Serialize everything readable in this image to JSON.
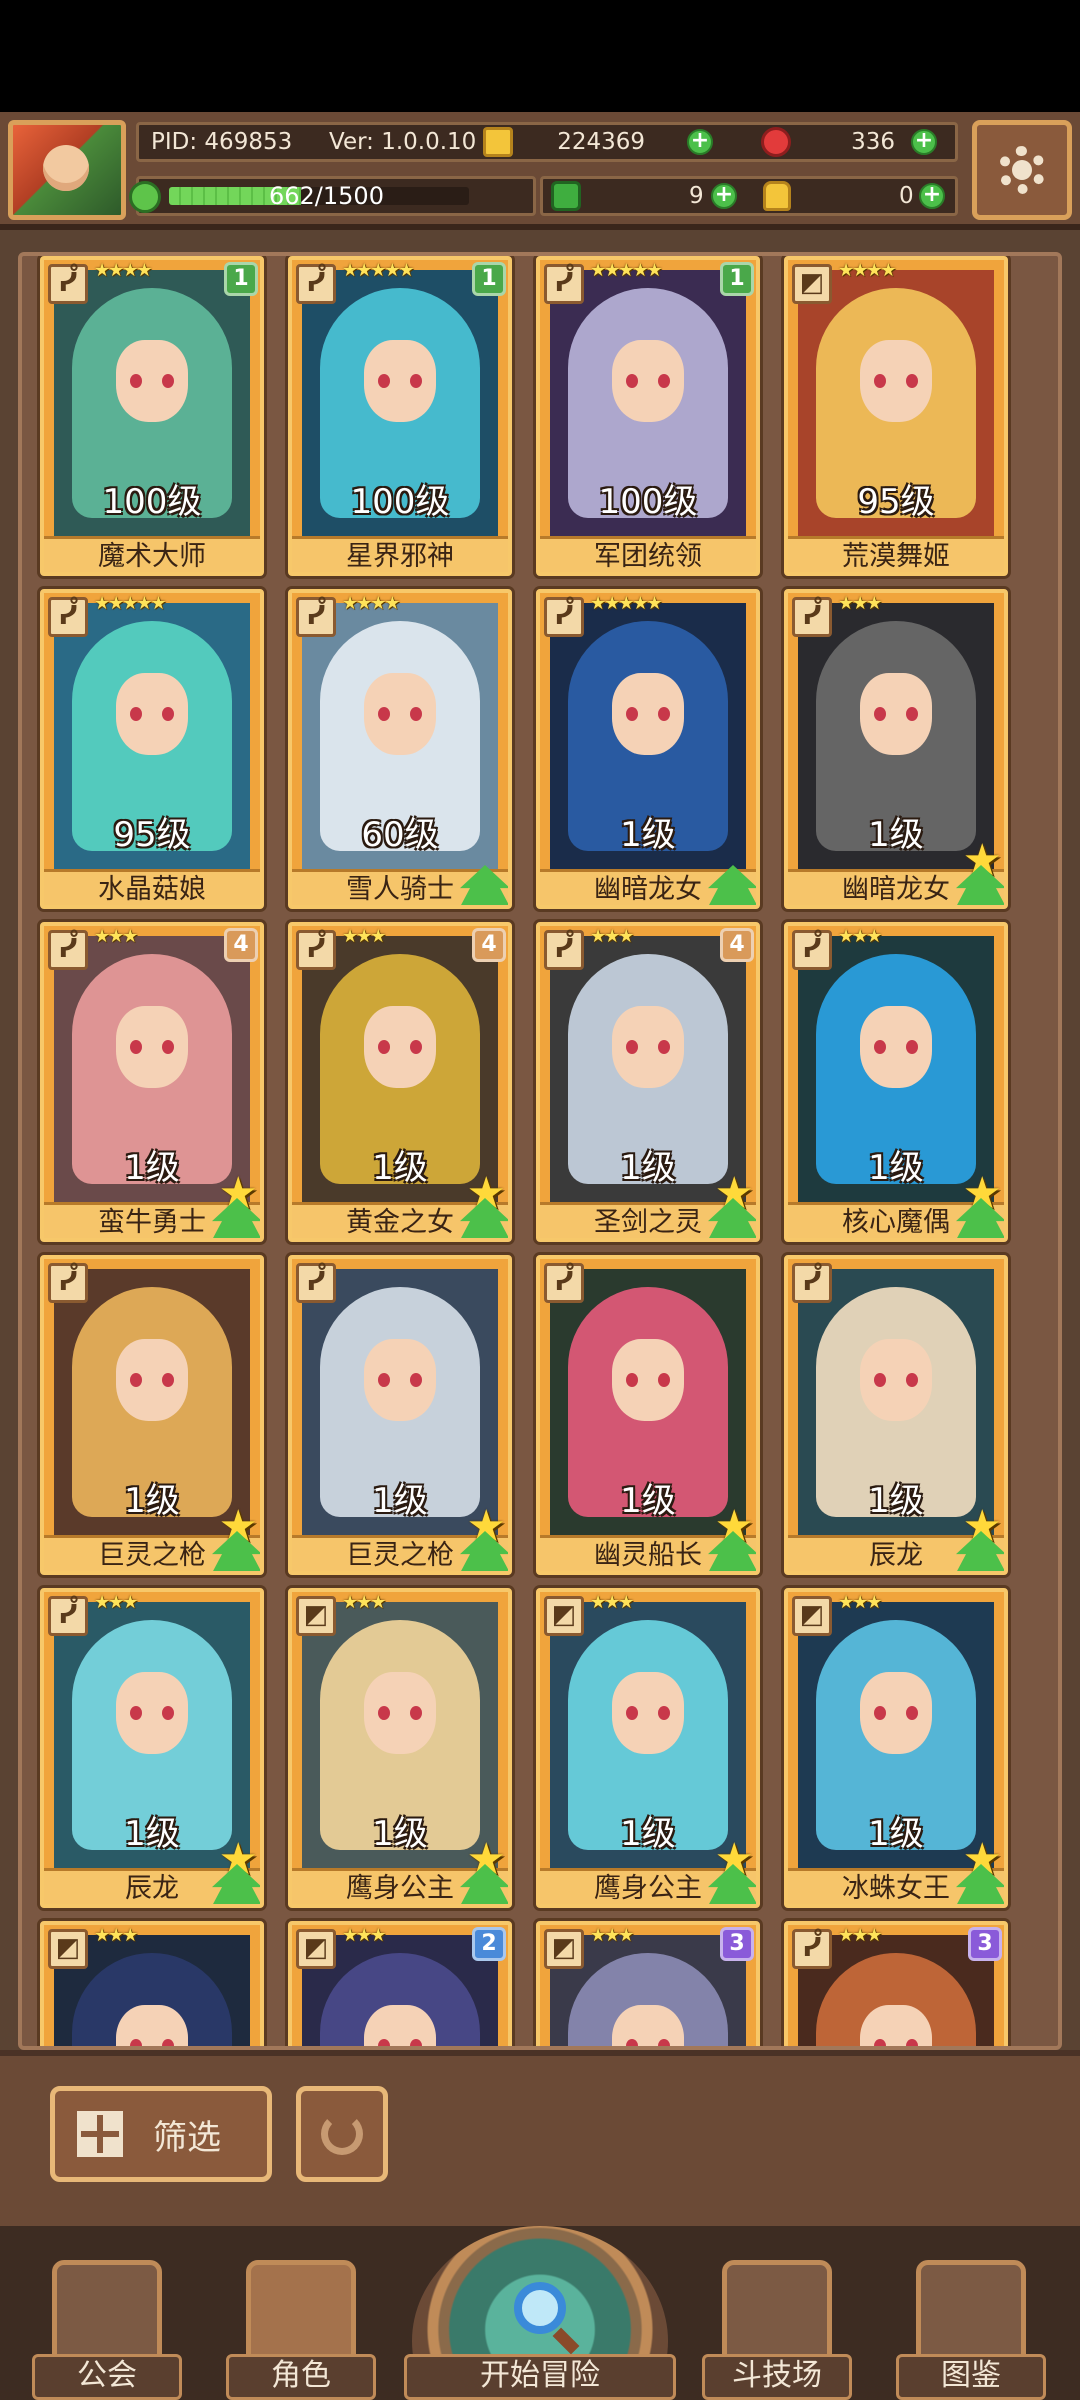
{
  "header": {
    "pid": "PID: 469853",
    "version": "Ver: 1.0.0.10",
    "gold": "224369",
    "gems": "336",
    "stamina": "662/1500",
    "stamina_fraction": 0.44,
    "clover": "9",
    "bag": "0",
    "plus": "+"
  },
  "cards": [
    {
      "name": "魔术大师",
      "level": "100级",
      "stars": "★★★★",
      "badge": "1",
      "badge_color": "#4aa84a",
      "hair": "#5fb89a",
      "bg": "#2f5a56",
      "type": "ᓮ",
      "up_star": false,
      "up_tree": false
    },
    {
      "name": "星界邪神",
      "level": "100级",
      "stars": "★★★★★",
      "badge": "1",
      "badge_color": "#4aa84a",
      "hair": "#4ac3d6",
      "bg": "#1e4e66",
      "type": "ᓮ",
      "up_star": false,
      "up_tree": false
    },
    {
      "name": "军团统领",
      "level": "100级",
      "stars": "★★★★★",
      "badge": "1",
      "badge_color": "#4aa84a",
      "hair": "#b7b2d8",
      "bg": "#3b2c52",
      "type": "ᓮ",
      "up_star": false,
      "up_tree": false
    },
    {
      "name": "荒漠舞姬",
      "level": "95级",
      "stars": "★★★★",
      "badge": "",
      "badge_color": "",
      "hair": "#f2c25a",
      "bg": "#a8442a",
      "type": "◩",
      "up_star": false,
      "up_tree": false
    },
    {
      "name": "水晶菇娘",
      "level": "95级",
      "stars": "★★★★★",
      "badge": "",
      "badge_color": "",
      "hair": "#57d2c2",
      "bg": "#2a6a86",
      "type": "ᓮ",
      "up_star": false,
      "up_tree": false
    },
    {
      "name": "雪人骑士",
      "level": "60级",
      "stars": "★★★★",
      "badge": "",
      "badge_color": "",
      "hair": "#e4ecf2",
      "bg": "#6a8aa0",
      "type": "ᓮ",
      "up_star": false,
      "up_tree": true
    },
    {
      "name": "幽暗龙女",
      "level": "1级",
      "stars": "★★★★★",
      "badge": "",
      "badge_color": "",
      "hair": "#2a5ea8",
      "bg": "#1a2c4a",
      "type": "ᓮ",
      "up_star": false,
      "up_tree": true
    },
    {
      "name": "幽暗龙女",
      "level": "1级",
      "stars": "★★★",
      "badge": "",
      "badge_color": "",
      "hair": "#6a6a6a",
      "bg": "#2a2a2e",
      "type": "ᓮ",
      "up_star": true,
      "up_tree": true
    },
    {
      "name": "蛮牛勇士",
      "level": "1级",
      "stars": "★★★",
      "badge": "4",
      "badge_color": "#d99a5a",
      "hair": "#e89a9a",
      "bg": "#6a4a4a",
      "type": "ᓮ",
      "up_star": true,
      "up_tree": true
    },
    {
      "name": "黄金之女",
      "level": "1级",
      "stars": "★★★",
      "badge": "4",
      "badge_color": "#d99a5a",
      "hair": "#d8b03a",
      "bg": "#4a3a2a",
      "type": "ᓮ",
      "up_star": true,
      "up_tree": true
    },
    {
      "name": "圣剑之灵",
      "level": "1级",
      "stars": "★★★",
      "badge": "4",
      "badge_color": "#d99a5a",
      "hair": "#c8d4e2",
      "bg": "#3a3a3a",
      "type": "ᓮ",
      "up_star": true,
      "up_tree": true
    },
    {
      "name": "核心魔偶",
      "level": "1级",
      "stars": "★★★",
      "badge": "",
      "badge_color": "",
      "hair": "#2aa2e2",
      "bg": "#1e3a3e",
      "type": "ᓮ",
      "up_star": true,
      "up_tree": true
    },
    {
      "name": "巨灵之枪",
      "level": "1级",
      "stars": "",
      "badge": "",
      "badge_color": "",
      "hair": "#e8b25a",
      "bg": "#5a3a2a",
      "type": "ᓮ",
      "up_star": true,
      "up_tree": true
    },
    {
      "name": "巨灵之枪",
      "level": "1级",
      "stars": "",
      "badge": "",
      "badge_color": "",
      "hair": "#d4dce6",
      "bg": "#3a4a5e",
      "type": "ᓮ",
      "up_star": true,
      "up_tree": true
    },
    {
      "name": "幽灵船长",
      "level": "1级",
      "stars": "",
      "badge": "",
      "badge_color": "",
      "hair": "#e25a7a",
      "bg": "#2a3a2e",
      "type": "ᓮ",
      "up_star": true,
      "up_tree": true
    },
    {
      "name": "辰龙",
      "level": "1级",
      "stars": "",
      "badge": "",
      "badge_color": "",
      "hair": "#f0dcc0",
      "bg": "#2a4a52",
      "type": "ᓮ",
      "up_star": true,
      "up_tree": true
    },
    {
      "name": "辰龙",
      "level": "1级",
      "stars": "★★★",
      "badge": "",
      "badge_color": "",
      "hair": "#7ad8e2",
      "bg": "#2a5a66",
      "type": "ᓮ",
      "up_star": true,
      "up_tree": true
    },
    {
      "name": "鹰身公主",
      "level": "1级",
      "stars": "★★★",
      "badge": "",
      "badge_color": "",
      "hair": "#f0d49a",
      "bg": "#4a5a5a",
      "type": "◩",
      "up_star": true,
      "up_tree": true
    },
    {
      "name": "鹰身公主",
      "level": "1级",
      "stars": "★★★",
      "badge": "",
      "badge_color": "",
      "hair": "#6ad4e2",
      "bg": "#2a4a5e",
      "type": "◩",
      "up_star": true,
      "up_tree": true
    },
    {
      "name": "冰蛛女王",
      "level": "1级",
      "stars": "★★★",
      "badge": "",
      "badge_color": "",
      "hair": "#5ac0e2",
      "bg": "#1e3a52",
      "type": "◩",
      "up_star": true,
      "up_tree": true
    },
    {
      "name": "",
      "level": "",
      "stars": "★★★",
      "badge": "",
      "badge_color": "",
      "hair": "#2a3a6a",
      "bg": "#1e2a3e",
      "type": "◩",
      "up_star": false,
      "up_tree": false
    },
    {
      "name": "",
      "level": "",
      "stars": "★★★",
      "badge": "2",
      "badge_color": "#4a8ad9",
      "hair": "#4a4a8a",
      "bg": "#2a2a4a",
      "type": "◩",
      "up_star": false,
      "up_tree": false
    },
    {
      "name": "",
      "level": "",
      "stars": "★★★",
      "badge": "3",
      "badge_color": "#8a5ad9",
      "hair": "#8a8ab2",
      "bg": "#3a3a4a",
      "type": "◩",
      "up_star": false,
      "up_tree": false
    },
    {
      "name": "",
      "level": "",
      "stars": "★★★",
      "badge": "3",
      "badge_color": "#8a5ad9",
      "hair": "#c86a3a",
      "bg": "#4a2a1e",
      "type": "ᓮ",
      "up_star": false,
      "up_tree": false
    }
  ],
  "actions": {
    "filter_label": "筛选"
  },
  "nav": {
    "guild": "公会",
    "characters": "角色",
    "adventure": "开始冒险",
    "arena": "斗技场",
    "codex": "图鉴"
  }
}
